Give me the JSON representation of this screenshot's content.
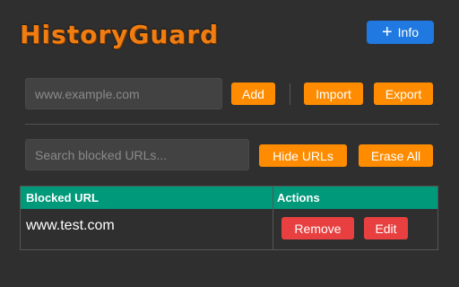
{
  "app": {
    "title": "HistoryGuard"
  },
  "header": {
    "info_label": "Info"
  },
  "add_form": {
    "url_placeholder": "www.example.com",
    "add_label": "Add",
    "import_label": "Import",
    "export_label": "Export"
  },
  "search": {
    "placeholder": "Search blocked URLs...",
    "hide_label": "Hide URLs",
    "erase_label": "Erase All"
  },
  "table": {
    "columns": [
      "Blocked URL",
      "Actions"
    ],
    "rows": [
      {
        "url": "www.test.com",
        "remove_label": "Remove",
        "edit_label": "Edit"
      }
    ]
  },
  "colors": {
    "accent": "#ff8c00",
    "info_button": "#1f79e0",
    "table_header": "#00997a",
    "danger": "#e84040"
  }
}
